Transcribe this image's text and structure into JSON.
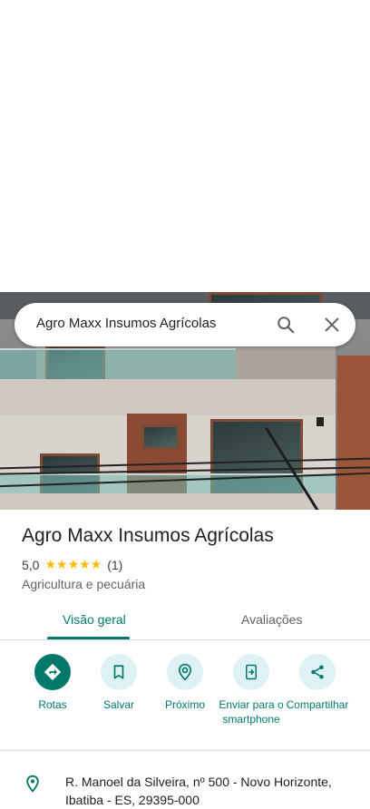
{
  "search": {
    "query": "Agro Maxx Insumos Agrícolas"
  },
  "place": {
    "name": "Agro Maxx Insumos Agrícolas",
    "rating": "5,0",
    "stars": "★★★★★",
    "review_count": "(1)",
    "category": "Agricultura e pecuária"
  },
  "tabs": [
    {
      "label": "Visão geral",
      "active": true
    },
    {
      "label": "Avaliações",
      "active": false
    }
  ],
  "actions": [
    {
      "label": "Rotas",
      "icon": "directions-icon"
    },
    {
      "label": "Salvar",
      "icon": "bookmark-icon"
    },
    {
      "label": "Próximo",
      "icon": "nearby-icon"
    },
    {
      "label": "Enviar para o smartphone",
      "icon": "send-to-phone-icon"
    },
    {
      "label": "Compartilhar",
      "icon": "share-icon"
    }
  ],
  "address": {
    "text": "R. Manoel da Silveira, nº 500 - Novo Horizonte, Ibatiba - ES, 29395-000"
  },
  "colors": {
    "accent": "#00796b",
    "action_bg": "#def2f6",
    "star": "#fbbc04"
  }
}
